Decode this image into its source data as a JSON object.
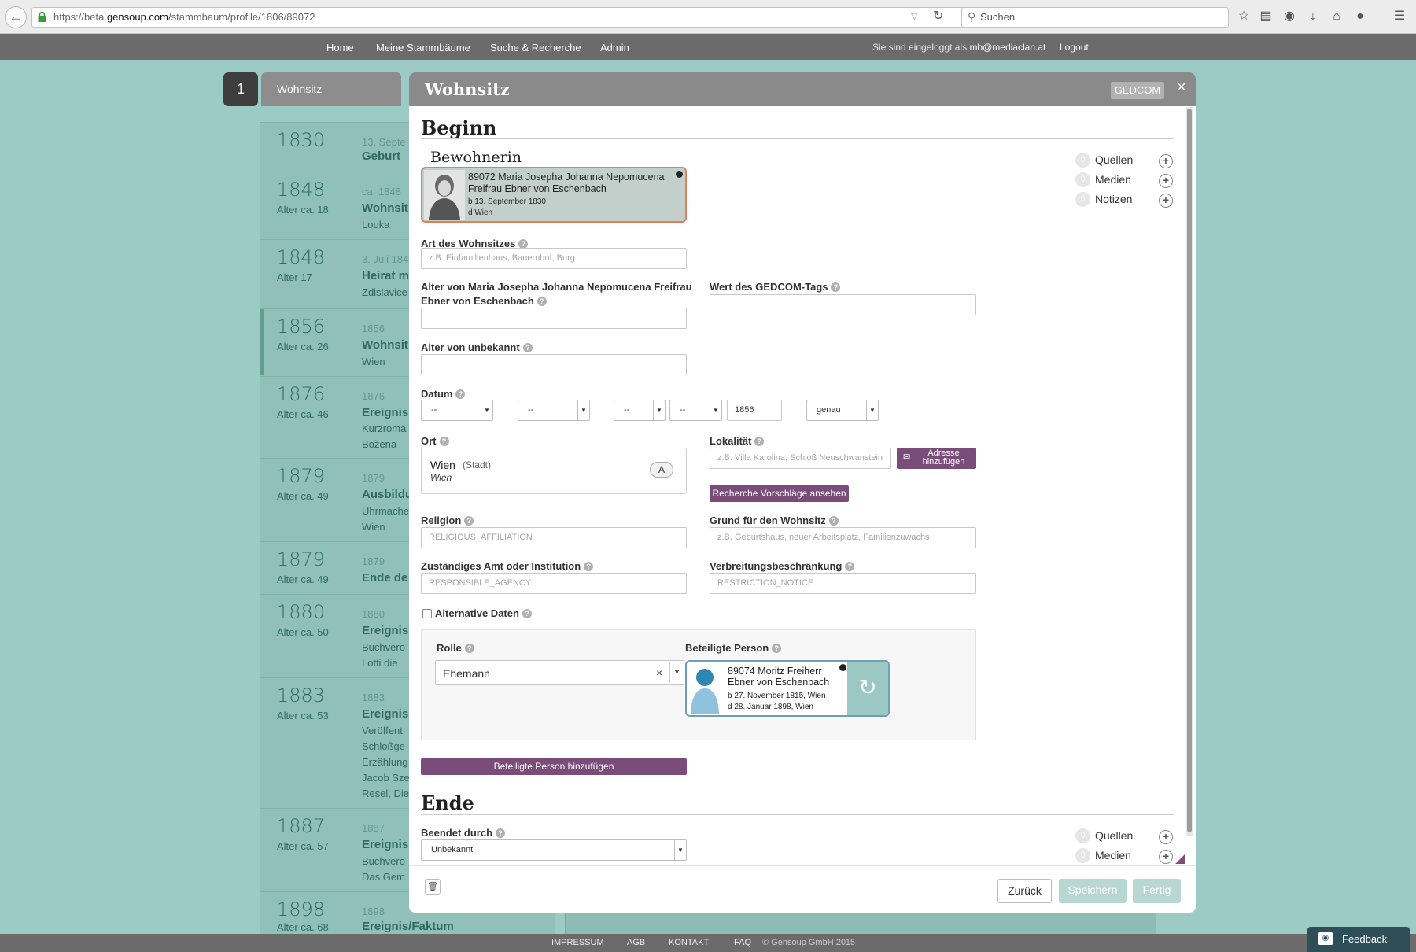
{
  "browser": {
    "url_prefix": "https://beta.",
    "url_host": "gensoup.com",
    "url_path": "/stammbaum/profile/1806/89072",
    "search_placeholder": "Suchen"
  },
  "nav": {
    "items": [
      "Home",
      "Meine Stammbäume",
      "Suche & Recherche",
      "Admin"
    ],
    "login_prefix": "Sie sind eingeloggt als",
    "login_user": "mb@mediaclan.at",
    "logout": "Logout"
  },
  "background": {
    "step_number": "1",
    "step_label": "Wohnsitz",
    "timeline": [
      {
        "year": "1830",
        "age": "",
        "date": "13. Septe",
        "title": "Geburt",
        "lines": []
      },
      {
        "year": "1848",
        "age": "Alter ca. 18",
        "date": "ca. 1848",
        "title": "Wohnsit",
        "lines": [
          "Louka"
        ]
      },
      {
        "year": "1848",
        "age": "Alter 17",
        "date": "3. Juli 184",
        "title": "Heirat m",
        "lines": [
          "Zdislavice"
        ]
      },
      {
        "year": "1856",
        "age": "Alter ca. 26",
        "date": "1856",
        "title": "Wohnsit",
        "lines": [
          "Wien"
        ]
      },
      {
        "year": "1876",
        "age": "Alter ca. 46",
        "date": "1876",
        "title": "Ereignis",
        "lines": [
          "Kurzroma",
          "Božena"
        ]
      },
      {
        "year": "1879",
        "age": "Alter ca. 49",
        "date": "1879",
        "title": "Ausbildu",
        "lines": [
          "Uhrmache",
          "Wien"
        ]
      },
      {
        "year": "1879",
        "age": "Alter ca. 49",
        "date": "1879",
        "title": "Ende de",
        "lines": []
      },
      {
        "year": "1880",
        "age": "Alter ca. 50",
        "date": "1880",
        "title": "Ereignis",
        "lines": [
          "Buchverö",
          "Lotti die"
        ]
      },
      {
        "year": "1883",
        "age": "Alter ca. 53",
        "date": "1883",
        "title": "Ereignis",
        "lines": [
          "Veröffent",
          "Schloßge",
          "Erzählung",
          "Jacob Sze",
          "Resel, Die"
        ]
      },
      {
        "year": "1887",
        "age": "Alter ca. 57",
        "date": "1887",
        "title": "Ereignis",
        "lines": [
          "Buchverö",
          "Das Gem"
        ]
      },
      {
        "year": "1898",
        "age": "Alter ca. 68",
        "date": "1898",
        "title": "Ereignis/Faktum",
        "lines": []
      }
    ]
  },
  "modal": {
    "title": "Wohnsitz",
    "gedcom_button": "GEDCOM",
    "close": "×",
    "section_begin": "Beginn",
    "bewohnerin_label": "Bewohnerin",
    "person": {
      "name": "89072 Maria Josepha Johanna Nepomucena Freifrau Ebner von Eschenbach",
      "birth": "b  13. September 1830",
      "death": "d  Wien"
    },
    "side_links": [
      {
        "count": "0",
        "label": "Quellen"
      },
      {
        "count": "0",
        "label": "Medien"
      },
      {
        "count": "0",
        "label": "Notizen"
      }
    ],
    "fields": {
      "art_label": "Art des Wohnsitzes",
      "art_placeholder": "z.B. Einfamilienhaus, Bauernhof, Burg",
      "alter_person_label_1": "Alter von Maria Josepha Johanna Nepomucena Freifrau",
      "alter_person_label_2": "Ebner von Eschenbach",
      "gedcom_tag_label": "Wert des GEDCOM-Tags",
      "alter_unbekannt_label": "Alter von unbekannt",
      "datum_label": "Datum",
      "datum_day": "--",
      "datum_month": "--",
      "datum_a": "--",
      "datum_b": "--",
      "datum_year": "1856",
      "datum_precision": "genau",
      "ort_label": "Ort",
      "ort_city": "Wien",
      "ort_type": "(Stadt)",
      "ort_region": "Wien",
      "ort_button": "A",
      "lokalitaet_label": "Lokalität",
      "lokalitaet_placeholder": "z.B. Villa Karolina, Schloß Neuschwanstein",
      "adresse_button_1": "Adresse",
      "adresse_button_2": "hinzufügen",
      "recherche_button": "Recherche Vorschläge ansehen",
      "religion_label": "Religion",
      "religion_placeholder": "RELIGIOUS_AFFILIATION",
      "grund_label": "Grund für den Wohnsitz",
      "grund_placeholder": "z.B. Geburtshaus, neuer Arbeitsplatz, Familienzuwachs",
      "amt_label": "Zuständiges Amt oder Institution",
      "amt_placeholder": "RESPONSIBLE_AGENCY",
      "verbreitung_label": "Verbreitungsbeschränkung",
      "verbreitung_placeholder": "RESTRICTION_NOTICE",
      "alternative_label": "Alternative Daten"
    },
    "role": {
      "label": "Rolle",
      "value": "Ehemann",
      "person_label": "Beteiligte Person",
      "person_name": "89074 Moritz Freiherr Ebner von Eschenbach",
      "person_birth": "b  27. November 1815, Wien",
      "person_death": "d  28. Januar 1898, Wien"
    },
    "add_person_button": "Beteiligte Person hinzufügen",
    "section_end": "Ende",
    "end_label": "Beendet durch",
    "end_value": "Unbekannt",
    "end_side_links": [
      {
        "count": "0",
        "label": "Quellen"
      },
      {
        "count": "0",
        "label": "Medien"
      }
    ],
    "footer": {
      "back": "Zurück",
      "save": "Speichern",
      "done": "Fertig"
    }
  },
  "page_footer": {
    "links": [
      "IMPRESSUM",
      "AGB",
      "KONTAKT",
      "FAQ"
    ],
    "copyright": "© Gensoup GmbH 2015",
    "feedback": "Feedback"
  },
  "colors": {
    "teal_background": "#9ccac5",
    "nav_gray": "#6b6b6b",
    "purple_accent": "#7a4c7a",
    "person_card_border": "#e47e56"
  }
}
